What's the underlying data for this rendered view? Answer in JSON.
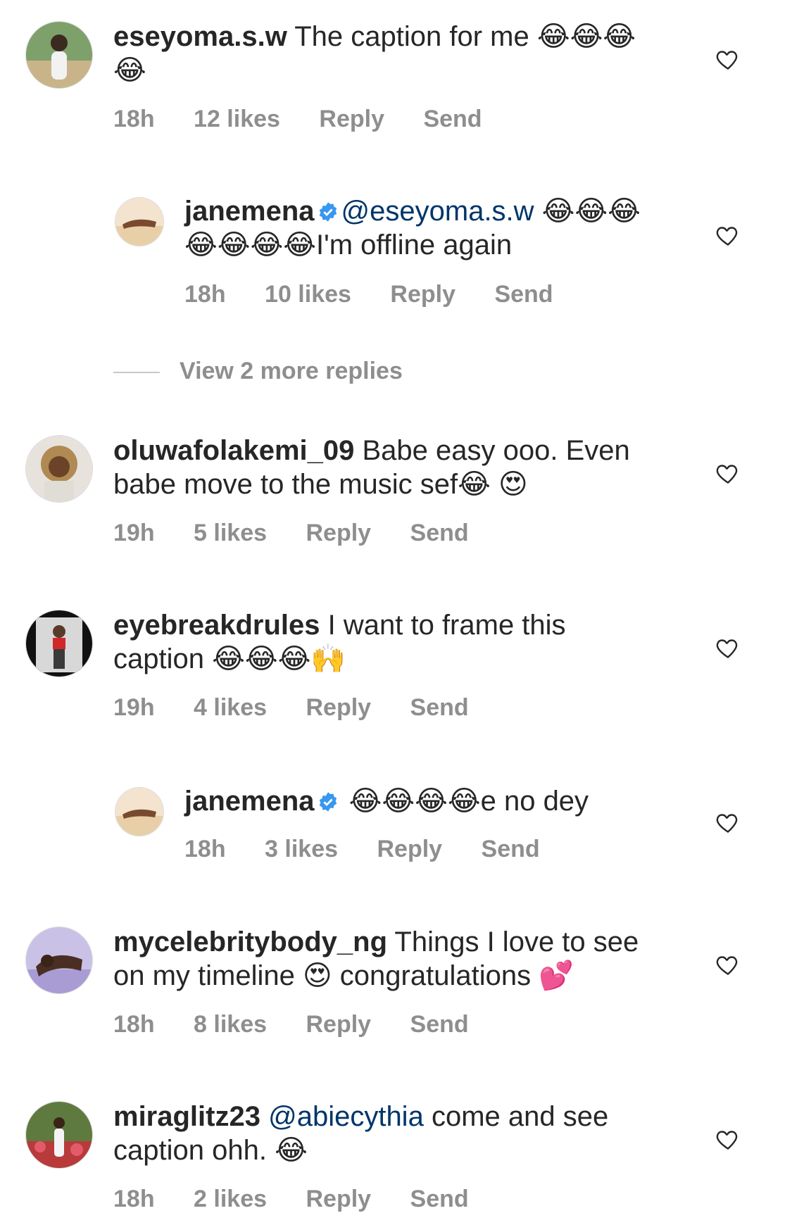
{
  "comments": [
    {
      "username": "eseyoma.s.w",
      "text": "The caption for me 😂😂😂😂",
      "time": "18h",
      "likes": "12 likes",
      "reply": "Reply",
      "send": "Send"
    },
    {
      "username": "janemena",
      "mention": "@eseyoma.s.w",
      "text": " 😂😂😂😂😂😂😂I'm offline again",
      "time": "18h",
      "likes": "10 likes",
      "reply": "Reply",
      "send": "Send"
    },
    {
      "username": "oluwafolakemi_09",
      "text": "Babe easy ooo. Even babe move to the music sef😂 😍",
      "time": "19h",
      "likes": "5 likes",
      "reply": "Reply",
      "send": "Send"
    },
    {
      "username": "eyebreakdrules",
      "text": "I want to frame this caption 😂😂😂🙌",
      "time": "19h",
      "likes": "4 likes",
      "reply": "Reply",
      "send": "Send"
    },
    {
      "username": "janemena",
      "text": " 😂😂😂😂e no dey",
      "time": "18h",
      "likes": "3 likes",
      "reply": "Reply",
      "send": "Send"
    },
    {
      "username": "mycelebritybody_ng",
      "text": "Things I love to see on my timeline 😍 congratulations 💕",
      "time": "18h",
      "likes": "8 likes",
      "reply": "Reply",
      "send": "Send"
    },
    {
      "username": "miraglitz23",
      "mention": "@abiecythia",
      "text": "  come and see caption ohh. 😂",
      "time": "18h",
      "likes": "2 likes",
      "reply": "Reply",
      "send": "Send"
    }
  ],
  "view_more_replies": "View 2 more replies",
  "colors": {
    "text": "#262626",
    "meta": "#8e8e8e",
    "mention": "#003569",
    "verified": "#3897f0"
  }
}
